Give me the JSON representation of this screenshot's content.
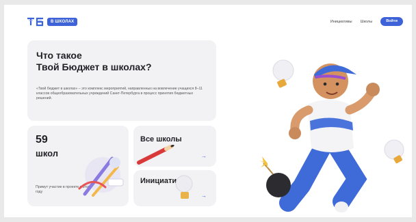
{
  "header": {
    "logo_text": "ТБ",
    "badge_label": "В ШКОЛАХ",
    "nav": [
      "Инициативы",
      "Школы"
    ],
    "login_label": "Войти"
  },
  "hero": {
    "title_line1": "Что такое",
    "title_line2": "Твой Бюджет в школах?",
    "description": "«Твой бюджет в школах» – это комплекс мероприятий, направленных на вовлечение учащихся 8–11 классов общеобразовательных учреждений Санкт-Петербурга в процесс принятия бюджетных решений."
  },
  "stat": {
    "number": "59",
    "unit": "школ",
    "note": "Примут участие в проекте в этом году"
  },
  "tiles": {
    "schools_label": "Все школы",
    "initiatives_label": "Инициативы",
    "arrow": "→"
  },
  "colors": {
    "accent": "#3e63d9",
    "card_bg": "#f2f2f4",
    "text": "#1f1f25"
  }
}
